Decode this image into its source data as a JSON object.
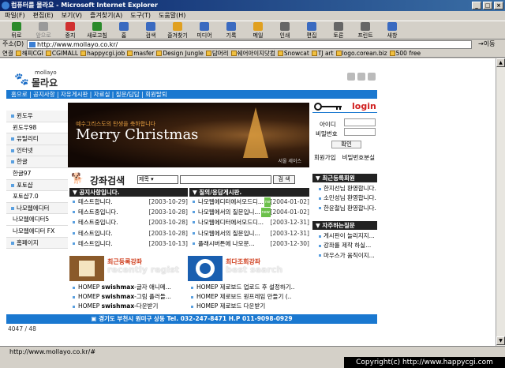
{
  "window": {
    "title": "컴퓨터를 몰라요 - Microsoft Internet Explorer"
  },
  "menu": [
    "파일(F)",
    "편집(E)",
    "보기(V)",
    "즐겨찾기(A)",
    "도구(T)",
    "도움말(H)"
  ],
  "toolbar": [
    {
      "label": "뒤로",
      "color": "#2a8a2a"
    },
    {
      "label": "앞으로",
      "color": "#9a9a9a",
      "disabled": true
    },
    {
      "label": "중지",
      "color": "#d03030"
    },
    {
      "label": "새로고침",
      "color": "#2a8a2a"
    },
    {
      "label": "홈",
      "color": "#3a6ac0"
    },
    {
      "label": "검색",
      "color": "#3a6ac0"
    },
    {
      "label": "즐겨찾기",
      "color": "#e0a020"
    },
    {
      "label": "미디어",
      "color": "#3a6ac0"
    },
    {
      "label": "기록",
      "color": "#3a6ac0"
    },
    {
      "label": "메일",
      "color": "#e0a020"
    },
    {
      "label": "인쇄",
      "color": "#666666"
    },
    {
      "label": "편집",
      "color": "#3a6ac0"
    },
    {
      "label": "토론",
      "color": "#666666"
    },
    {
      "label": "프린트",
      "color": "#666666"
    },
    {
      "label": "새창",
      "color": "#3a6ac0"
    }
  ],
  "address": {
    "label": "주소(D)",
    "value": "http://www.mollayo.co.kr/",
    "go": "이동"
  },
  "links": {
    "label": "연결",
    "items": [
      "해피CGI",
      "CGIMALL",
      "happycgi.job",
      "masfer",
      "Design Jungle",
      "담머리",
      "쉐어아이지닷컴",
      "Snowcat",
      "TJ art",
      "logo.corean.biz",
      "500 free"
    ]
  },
  "site": {
    "logo_small": "mollayo",
    "logo_big": "몰라요",
    "nav": "홈으로 | 공지사항 | 자유게시판 | 자료실 | 질문/답답 | 회원탈퇴",
    "leftmenu": [
      {
        "label": "윈도우",
        "sec": true
      },
      {
        "label": "윈도우98",
        "sec": false
      },
      {
        "label": "유틸리티",
        "sec": true
      },
      {
        "label": "인터넷",
        "sec": true
      },
      {
        "label": "한글",
        "sec": true
      },
      {
        "label": "한글97",
        "sec": false
      },
      {
        "label": "포토샵",
        "sec": true
      },
      {
        "label": "포토샵7.0",
        "sec": false
      },
      {
        "label": "나모웹에디터",
        "sec": true
      },
      {
        "label": "나모웹에디터5",
        "sec": false
      },
      {
        "label": "나모웹에디터 FX",
        "sec": false
      },
      {
        "label": "홈페이지",
        "sec": true
      }
    ],
    "banner": {
      "small": "예수그리스도의 탄생을 축하합니다",
      "big": "Merry Christmas",
      "caption": "서울 세이스"
    },
    "login": {
      "title": "login",
      "id_label": "아이디",
      "pw_label": "비밀번호",
      "confirm": "확인",
      "join": "회원가입",
      "find": "비밀번호분실"
    },
    "search": {
      "title": "강좌검색",
      "select": "제목",
      "button": "검 색"
    },
    "notice": {
      "title": "공지사항입니다.",
      "rows": [
        {
          "t": "테스트합니다.",
          "d": "[2003-10-29]"
        },
        {
          "t": "테스트중입니다.",
          "d": "[2003-10-28]"
        },
        {
          "t": "테스트중입니다.",
          "d": "[2003-10-28]"
        },
        {
          "t": "테스트입니다.",
          "d": "[2003-10-28]"
        },
        {
          "t": "테스트입니다.",
          "d": "[2003-10-13]"
        }
      ]
    },
    "qa": {
      "title": "질의/응답게시판.",
      "rows": [
        {
          "t": "나모웹에디터에서모드디...",
          "d": "[2004-01-02]",
          "new": "new"
        },
        {
          "t": "나모웹에서의 질문입니...",
          "d": "[2004-01-02]",
          "new": "new"
        },
        {
          "t": "나모웹에디터에서모드디...",
          "d": "[2003-12-31]",
          "new": ""
        },
        {
          "t": "나모웹에서의 질문입니...",
          "d": "[2003-12-31]",
          "new": ""
        },
        {
          "t": "플래시버튼에 나모문...",
          "d": "[2003-12-30]",
          "new": ""
        }
      ]
    },
    "recent_members": {
      "title": "최근등록회원",
      "items": [
        "한지선님 환영합니다.",
        "소민성님 환영합니다.",
        "한윤철님 환영합니다."
      ]
    },
    "faq": {
      "title": "자주하는질문",
      "items": [
        "게시판이 늘리지지...",
        "강좌를 제작 하실...",
        "마우스가 움직이지..."
      ]
    },
    "recent_lectures": {
      "title": "최근등록강좌",
      "en": "recently regist",
      "rows": [
        {
          "cat": "HOMEP",
          "b": "swishmax",
          "t": "-글자 애니메..."
        },
        {
          "cat": "HOMEP",
          "b": "swishmax",
          "t": "-그림 플러들..."
        },
        {
          "cat": "HOMEP",
          "b": "swishmax",
          "t": "-다운받기"
        }
      ]
    },
    "best_lectures": {
      "title": "최다조회강좌",
      "en": "best search",
      "rows": [
        {
          "cat": "HOMEP",
          "t": "제로보드 업로드 후 설정하기.."
        },
        {
          "cat": "HOMEP",
          "t": "제로보드 원프레임 만들기 (.."
        },
        {
          "cat": "HOMEP",
          "t": "제로보드 다운받기"
        }
      ]
    },
    "footer": "경기도 부천시 원미구 상동 Tel. 032-247-8471 H.P 011-9098-0929",
    "counter": "4047 / 48"
  },
  "status": {
    "url": "http://www.mollayo.co.kr/#"
  },
  "copyright": "Copyright(c) http://www.happycgi.com"
}
